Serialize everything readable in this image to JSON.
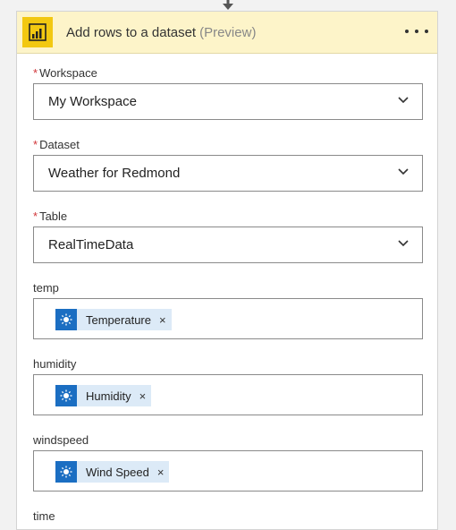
{
  "card": {
    "title": "Add rows to a dataset",
    "title_suffix": "(Preview)",
    "header_color": "#fdf4c9",
    "icon_color": "#f2c811",
    "icon": "power-bi-icon",
    "more_icon": "more-options-icon"
  },
  "fields": {
    "workspace": {
      "label": "Workspace",
      "required_mark": "*",
      "value": "My Workspace"
    },
    "dataset": {
      "label": "Dataset",
      "required_mark": "*",
      "value": "Weather for Redmond"
    },
    "table": {
      "label": "Table",
      "required_mark": "*",
      "value": "RealTimeData"
    },
    "temp": {
      "label": "temp",
      "token": "Temperature",
      "remove": "×"
    },
    "humidity": {
      "label": "humidity",
      "token": "Humidity",
      "remove": "×"
    },
    "windspeed": {
      "label": "windspeed",
      "token": "Wind Speed",
      "remove": "×"
    },
    "time": {
      "label": "time"
    }
  },
  "token_icon": "weather-sun-icon",
  "token_color": "#1b6ec2"
}
